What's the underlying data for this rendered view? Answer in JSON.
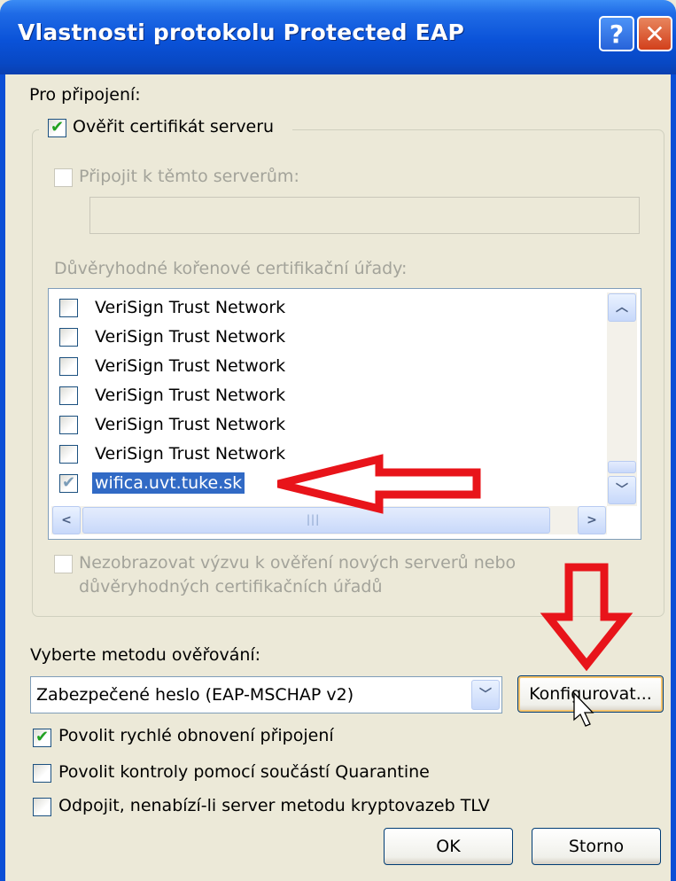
{
  "window": {
    "title": "Vlastnosti protokolu Protected EAP",
    "help_glyph": "?",
    "close_glyph": "✕"
  },
  "connection": {
    "label": "Pro připojení:",
    "verify_cert": {
      "label": "Ověřit certifikát serveru",
      "checked": true
    },
    "connect_servers": {
      "label": "Připojit k těmto serverům:",
      "checked": false,
      "enabled": false,
      "value": ""
    },
    "trusted_roots_label": "Důvěryhodné kořenové certifikační úřady:",
    "trusted_roots": [
      {
        "label": "VeriSign Trust Network",
        "checked": false
      },
      {
        "label": "VeriSign Trust Network",
        "checked": false
      },
      {
        "label": "VeriSign Trust Network",
        "checked": false
      },
      {
        "label": "VeriSign Trust Network",
        "checked": false
      },
      {
        "label": "VeriSign Trust Network",
        "checked": false
      },
      {
        "label": "VeriSign Trust Network",
        "checked": false
      },
      {
        "label": "wifica.uvt.tuke.sk",
        "checked": true,
        "selected": true
      }
    ],
    "no_prompt": {
      "label_line1": "Nezobrazovat výzvu k ověření nových serverů nebo",
      "label_line2": "důvěryhodných certifikačních úřadů",
      "checked": false,
      "enabled": false
    }
  },
  "method": {
    "label": "Vyberte metodu ověřování:",
    "selected": "Zabezpečené heslo (EAP-MSCHAP v2)",
    "configure_button": "Konfigurovat..."
  },
  "options": [
    {
      "label": "Povolit rychlé obnovení připojení",
      "checked": true
    },
    {
      "label": "Povolit kontroly pomocí součástí Quarantine",
      "checked": false
    },
    {
      "label": "Odpojit, nenabízí-li server metodu kryptovazeb TLV",
      "checked": false
    }
  ],
  "buttons": {
    "ok": "OK",
    "cancel": "Storno"
  },
  "colors": {
    "annotation_arrow": "#e8141a",
    "selection": "#316ac5",
    "check": "#21a121",
    "titlebar": "#0a52d8"
  }
}
